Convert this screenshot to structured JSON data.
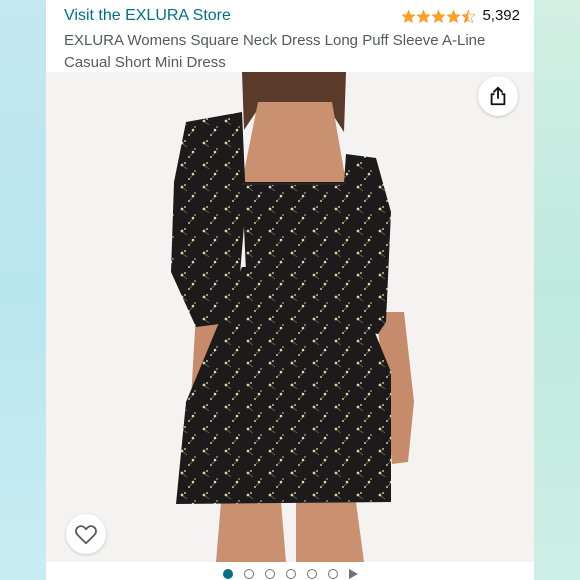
{
  "header": {
    "store_link": "Visit the EXLURA Store",
    "rating_count": "5,392",
    "rating_stars": 4.5
  },
  "product": {
    "title": "EXLURA Womens Square Neck Dress Long Puff Sleeve A-Line Casual Short Mini Dress"
  },
  "gallery": {
    "image": "black floral puff-sleeve square-neck mini dress on model",
    "total_images": 6,
    "active_index": 0,
    "has_video": true
  },
  "icons": {
    "share": "share-icon",
    "wishlist": "heart-icon"
  },
  "colors": {
    "link": "#007185",
    "star": "#FFA41C",
    "dot_active": "#007185"
  }
}
